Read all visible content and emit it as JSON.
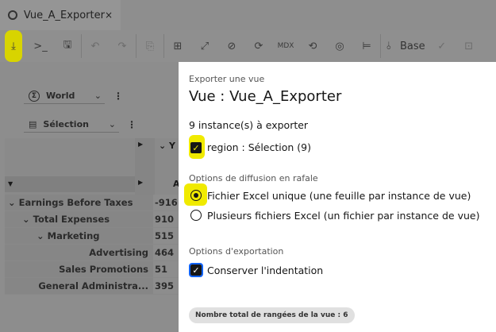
{
  "tab": {
    "title": "Vue_A_Exporter",
    "close": "×"
  },
  "toolbar": {
    "export": "⤓",
    "mdx_console": ">_",
    "save": "🖫",
    "undo": "↶",
    "redo": "↷",
    "sandbox": "⎘",
    "layout": "⊞",
    "swap": "⤢",
    "suppress": "⊘",
    "refresh": "⟳",
    "mdx": "MDX",
    "recalc": "⟲",
    "focus": "◎",
    "tree": "⊨",
    "sandbox_icon": "⫰",
    "base": "Base",
    "commit": "✓",
    "reset": "⊡"
  },
  "left": {
    "dimension_world": "World",
    "dimension_selection": "Sélection",
    "column_header_1": "Y",
    "column_header_2": "A",
    "rows": [
      {
        "label": "Earnings Before Taxes",
        "value": "-916",
        "level": 0,
        "expanded": true
      },
      {
        "label": "Total Expenses",
        "value": "910",
        "level": 1,
        "expanded": true
      },
      {
        "label": "Marketing",
        "value": "515",
        "level": 2,
        "expanded": true
      },
      {
        "label": "Advertising",
        "value": "464",
        "level": 3
      },
      {
        "label": "Sales Promotions",
        "value": "51",
        "level": 3
      },
      {
        "label": "General Administra...",
        "value": "395",
        "level": 3
      }
    ]
  },
  "dialog": {
    "subtitle": "Exporter une vue",
    "title": "Vue : Vue_A_Exporter",
    "instances": "9 instance(s) à exporter",
    "region_checkbox": "region : Sélection (9)",
    "burst_heading": "Options de diffusion en rafale",
    "burst_options": [
      "Fichier Excel unique (une feuille par instance de vue)",
      "Plusieurs fichiers Excel (un fichier par instance de vue)"
    ],
    "burst_selected": 0,
    "export_heading": "Options d'exportation",
    "indent_checkbox": "Conserver l'indentation",
    "row_count": "Nombre total de rangées de la vue : 6"
  },
  "colors": {
    "highlight": "#f0ea00",
    "overlay": "#8d8d8d"
  }
}
